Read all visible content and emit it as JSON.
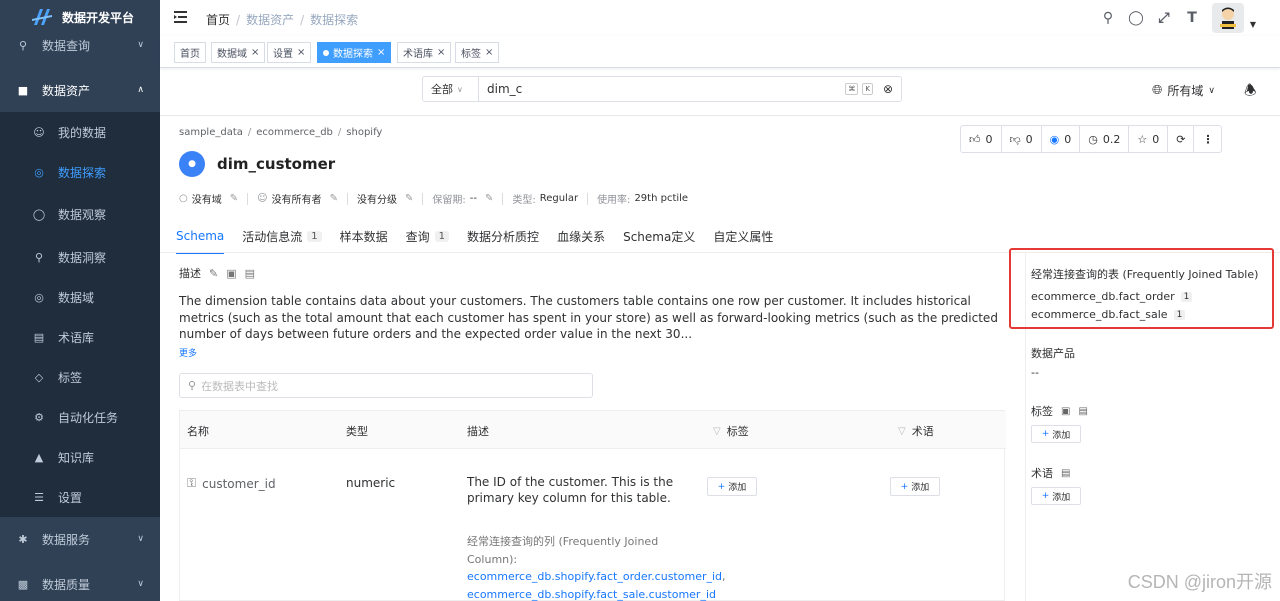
{
  "app": {
    "title": "数据开发平台"
  },
  "sidebar": {
    "items": [
      {
        "label": "数据查询",
        "level": "top",
        "icon": "search-icon"
      },
      {
        "label": "数据资产",
        "level": "top",
        "icon": "database-icon",
        "open": true
      },
      {
        "label": "我的数据",
        "level": "sub",
        "icon": "user-data-icon"
      },
      {
        "label": "数据探索",
        "level": "sub",
        "icon": "globe-icon",
        "active": true
      },
      {
        "label": "数据观察",
        "level": "sub",
        "icon": "observe-icon"
      },
      {
        "label": "数据洞察",
        "level": "sub",
        "icon": "insight-icon"
      },
      {
        "label": "数据域",
        "level": "sub",
        "icon": "domain-icon"
      },
      {
        "label": "术语库",
        "level": "sub",
        "icon": "book-icon"
      },
      {
        "label": "标签",
        "level": "sub",
        "icon": "tag-icon"
      },
      {
        "label": "自动化任务",
        "level": "sub",
        "icon": "automation-icon"
      },
      {
        "label": "知识库",
        "level": "sub",
        "icon": "knowledge-icon"
      },
      {
        "label": "设置",
        "level": "sub",
        "icon": "settings-icon"
      },
      {
        "label": "数据服务",
        "level": "top",
        "icon": "service-icon"
      },
      {
        "label": "数据质量",
        "level": "top",
        "icon": "quality-icon"
      }
    ]
  },
  "navbar": {
    "breadcrumb": [
      "首页",
      "数据资产",
      "数据探索"
    ],
    "separator": "/"
  },
  "tags": [
    {
      "label": "首页",
      "closable": false
    },
    {
      "label": "数据域",
      "closable": true
    },
    {
      "label": "设置",
      "closable": true
    },
    {
      "label": "数据探索",
      "closable": true,
      "active": true
    },
    {
      "label": "术语库",
      "closable": true
    },
    {
      "label": "标签",
      "closable": true
    }
  ],
  "search": {
    "scope": "全部",
    "query": "dim_c",
    "shortcut_keys": [
      "⌘",
      "K"
    ],
    "domain_filter": "所有域"
  },
  "entity": {
    "path": [
      "sample_data",
      "ecommerce_db",
      "shopify"
    ],
    "name": "dim_customer",
    "stats": {
      "likes": "0",
      "dislikes": "0",
      "watchers": "0",
      "version": "0.2",
      "stars": "0"
    },
    "meta": {
      "domain": "没有域",
      "owner": "没有所有者",
      "tier": "没有分级",
      "retention_label": "保留期:",
      "retention_value": "--",
      "type_label": "类型:",
      "type_value": "Regular",
      "usage_label": "使用率:",
      "usage_value": "29th pctile"
    }
  },
  "tabs": [
    {
      "label": "Schema",
      "active": true
    },
    {
      "label": "活动信息流",
      "badge": "1"
    },
    {
      "label": "样本数据"
    },
    {
      "label": "查询",
      "badge": "1"
    },
    {
      "label": "数据分析质控"
    },
    {
      "label": "血缘关系"
    },
    {
      "label": "Schema定义"
    },
    {
      "label": "自定义属性"
    }
  ],
  "description": {
    "label": "描述",
    "text": "The dimension table contains data about your customers. The customers table contains one row per customer. It includes historical metrics (such as the total amount that each customer has spent in your store) as well as forward-looking metrics (such as the predicted number of days between future orders and the expected order value in the next 30...",
    "more": "更多"
  },
  "column_search": {
    "placeholder": "在数据表中查找"
  },
  "table": {
    "headers": [
      "名称",
      "类型",
      "描述",
      "标签",
      "术语"
    ],
    "rows": [
      {
        "name": "customer_id",
        "type": "numeric",
        "description": "The ID of the customer. This is the primary key column for this table.",
        "tag_add": "添加",
        "term_add": "添加",
        "frequently_joined_label": "经常连接查询的列 (Frequently Joined Column):",
        "frequently_joined_links": [
          "ecommerce_db.shopify.fact_order.customer_id",
          "ecommerce_db.shopify.fact_sale.customer_id"
        ]
      }
    ]
  },
  "right_panel": {
    "joined_tables_title": "经常连接查询的表 (Frequently Joined Table)",
    "joined_tables": [
      {
        "name": "ecommerce_db.fact_order",
        "count": "1"
      },
      {
        "name": "ecommerce_db.fact_sale",
        "count": "1"
      }
    ],
    "data_product_title": "数据产品",
    "data_product_value": "--",
    "tags_title": "标签",
    "tags_add": "添加",
    "glossary_title": "术语",
    "glossary_add": "添加"
  },
  "watermark": "CSDN @jiron开源",
  "colors": {
    "sidebar_bg": "#304156",
    "accent": "#1677ff",
    "highlight": "#e53935"
  }
}
